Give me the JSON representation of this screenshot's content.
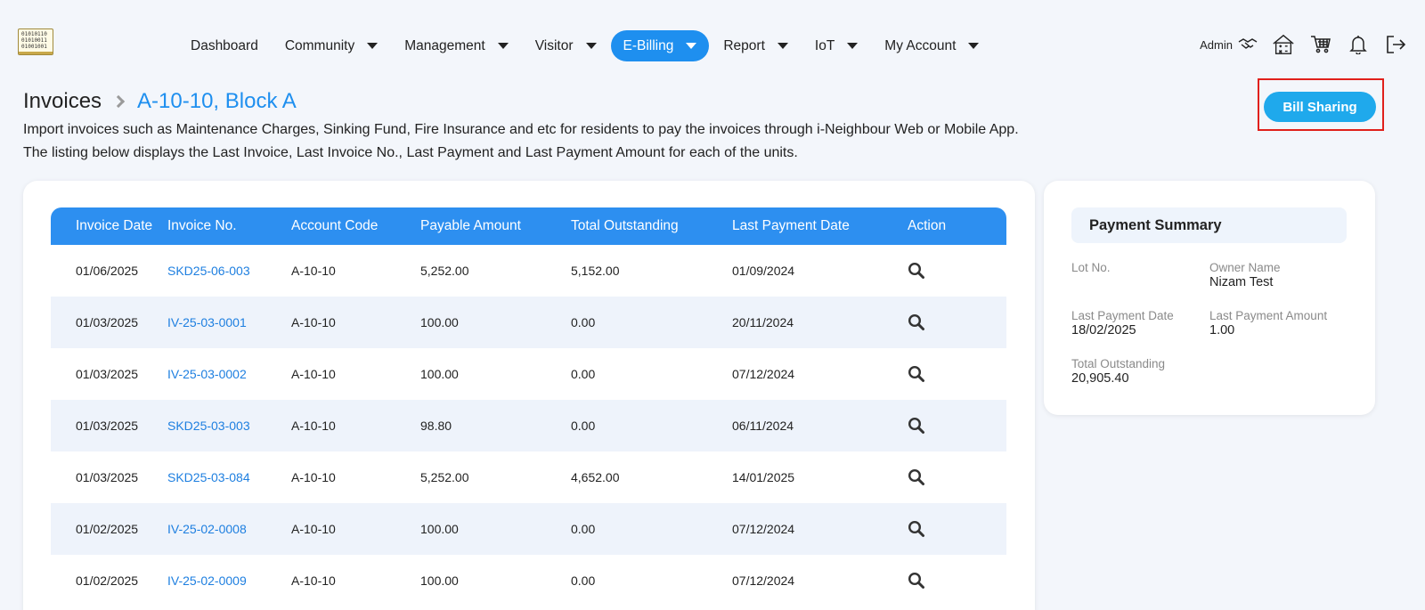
{
  "nav": {
    "items": [
      {
        "label": "Dashboard",
        "dropdown": false,
        "active": false
      },
      {
        "label": "Community",
        "dropdown": true,
        "active": false
      },
      {
        "label": "Management",
        "dropdown": true,
        "active": false
      },
      {
        "label": "Visitor",
        "dropdown": true,
        "active": false
      },
      {
        "label": "E-Billing",
        "dropdown": true,
        "active": true
      },
      {
        "label": "Report",
        "dropdown": true,
        "active": false
      },
      {
        "label": "IoT",
        "dropdown": true,
        "active": false
      },
      {
        "label": "My Account",
        "dropdown": true,
        "active": false
      }
    ],
    "user_label": "Admin",
    "accent": "#1e8fef"
  },
  "logo_text": "01010110 01010011 01001001",
  "page": {
    "crumb_root": "Invoices",
    "crumb_current": "A-10-10, Block A",
    "desc_line1": "Import invoices such as Maintenance Charges, Sinking Fund, Fire Insurance and etc for residents to pay the invoices through i-Neighbour Web or Mobile App.",
    "desc_line2": "The listing below displays the Last Invoice, Last Invoice No., Last Payment and Last Payment Amount for each of the units.",
    "bill_sharing_label": "Bill Sharing"
  },
  "table": {
    "headers": {
      "date": "Invoice Date",
      "no": "Invoice No.",
      "account": "Account Code",
      "payable": "Payable Amount",
      "outstanding": "Total Outstanding",
      "last_payment": "Last Payment Date",
      "action": "Action"
    },
    "rows": [
      {
        "date": "01/06/2025",
        "no": "SKD25-06-003",
        "account": "A-10-10",
        "payable": "5,252.00",
        "outstanding": "5,152.00",
        "last_payment": "01/09/2024"
      },
      {
        "date": "01/03/2025",
        "no": "IV-25-03-0001",
        "account": "A-10-10",
        "payable": "100.00",
        "outstanding": "0.00",
        "last_payment": "20/11/2024"
      },
      {
        "date": "01/03/2025",
        "no": "IV-25-03-0002",
        "account": "A-10-10",
        "payable": "100.00",
        "outstanding": "0.00",
        "last_payment": "07/12/2024"
      },
      {
        "date": "01/03/2025",
        "no": "SKD25-03-003",
        "account": "A-10-10",
        "payable": "98.80",
        "outstanding": "0.00",
        "last_payment": "06/11/2024"
      },
      {
        "date": "01/03/2025",
        "no": "SKD25-03-084",
        "account": "A-10-10",
        "payable": "5,252.00",
        "outstanding": "4,652.00",
        "last_payment": "14/01/2025"
      },
      {
        "date": "01/02/2025",
        "no": "IV-25-02-0008",
        "account": "A-10-10",
        "payable": "100.00",
        "outstanding": "0.00",
        "last_payment": "07/12/2024"
      },
      {
        "date": "01/02/2025",
        "no": "IV-25-02-0009",
        "account": "A-10-10",
        "payable": "100.00",
        "outstanding": "0.00",
        "last_payment": "07/12/2024"
      }
    ]
  },
  "summary": {
    "title": "Payment Summary",
    "lot_label": "Lot No.",
    "lot_value": "",
    "owner_label": "Owner Name",
    "owner_value": "Nizam Test",
    "last_date_label": "Last Payment Date",
    "last_date_value": "18/02/2025",
    "last_amount_label": "Last Payment Amount",
    "last_amount_value": "1.00",
    "outstanding_label": "Total Outstanding",
    "outstanding_value": "20,905.40"
  }
}
